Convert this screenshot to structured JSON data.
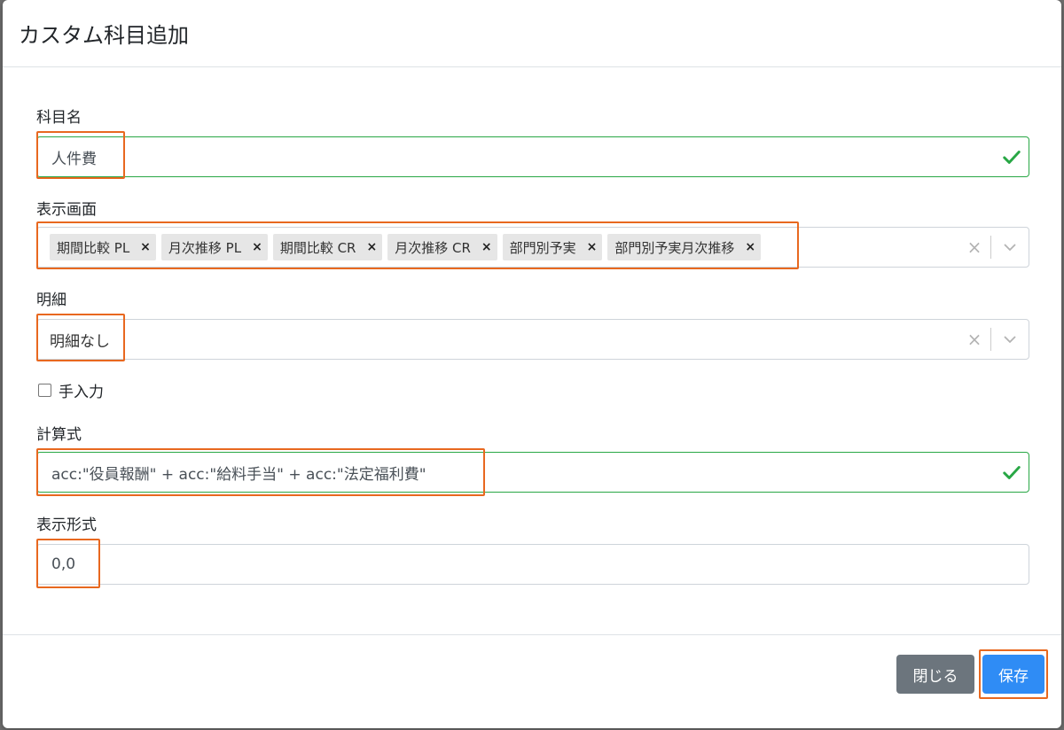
{
  "dialog": {
    "title": "カスタム科目追加"
  },
  "fields": {
    "account_name": {
      "label": "科目名",
      "value": "人件費"
    },
    "display_screens": {
      "label": "表示画面",
      "tags": [
        "期間比較 PL",
        "月次推移 PL",
        "期間比較 CR",
        "月次推移 CR",
        "部門別予実",
        "部門別予実月次推移"
      ]
    },
    "detail": {
      "label": "明細",
      "value": "明細なし"
    },
    "manual_input": {
      "label": "手入力",
      "checked": false
    },
    "formula": {
      "label": "計算式",
      "value": "acc:\"役員報酬\" + acc:\"給料手当\" + acc:\"法定福利費\""
    },
    "display_format": {
      "label": "表示形式",
      "value": "0,0"
    }
  },
  "footer": {
    "close_label": "閉じる",
    "save_label": "保存"
  },
  "icons": {
    "tag_remove": "×",
    "clear": "×",
    "valid": "check-icon",
    "dropdown": "chevron-down-icon"
  },
  "colors": {
    "valid_border": "#28a745",
    "primary": "#2f8cf5",
    "secondary": "#6c757d",
    "highlight": "#e8681f"
  }
}
